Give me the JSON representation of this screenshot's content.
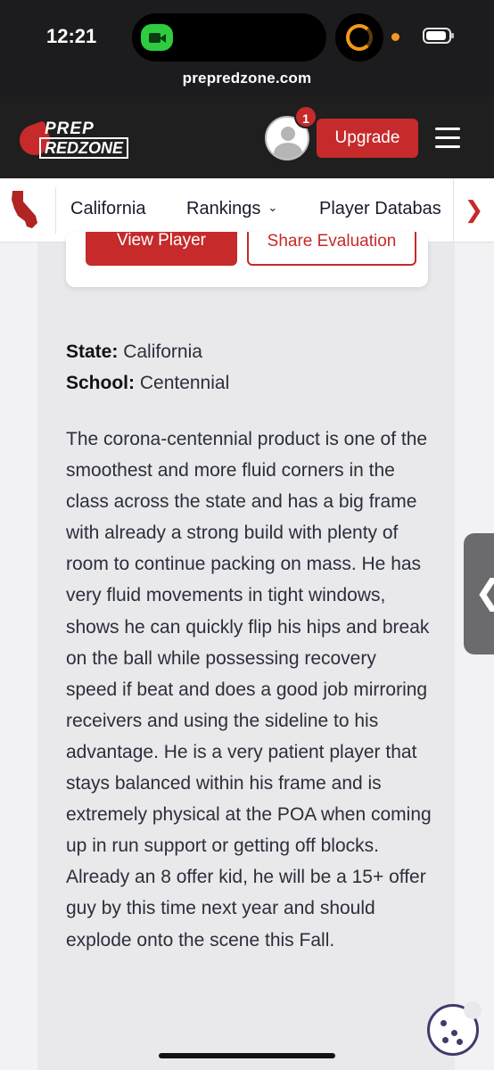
{
  "status_bar": {
    "time": "12:21",
    "url": "prepredzone.com",
    "icons": [
      "camera-icon",
      "timer-icon",
      "battery-icon"
    ],
    "colors": {
      "camera_pill": "#2ecc40",
      "timer": "#f19a1a"
    }
  },
  "header": {
    "logo_line1": "PREP",
    "logo_line2": "REDZONE",
    "notification_count": "1",
    "upgrade_label": "Upgrade",
    "icons": [
      "avatar-icon",
      "hamburger-menu-icon"
    ]
  },
  "nav": {
    "state_icon": "california-state-icon",
    "items": [
      {
        "label": "California"
      },
      {
        "label": "Rankings"
      },
      {
        "label": "Player Databas"
      }
    ],
    "next_icon": "chevron-right-icon"
  },
  "player_card": {
    "view_label": "View Player",
    "share_label": "Share Evaluation"
  },
  "info": {
    "state_label": "State:",
    "state_value": "California",
    "school_label": "School:",
    "school_value": "Centennial"
  },
  "evaluation": "The corona-centennial product is one of the smoothest and more fluid corners in the class across the state and has a big frame with already a strong build with plenty of room to continue packing on mass. He has very fluid movements in tight windows, shows he can quickly flip his hips and break on the ball while possessing recovery speed if beat and does a good job mirroring receivers and using the sideline to his advantage. He is a very patient player that stays balanced within his frame and is extremely physical at the POA when coming up in run support or getting off blocks. Already an 8 offer kid, he will be a 15+ offer guy by this time next year and should explode onto the scene this Fall.",
  "overlay": {
    "side_tab_icon": "chevron-left-icon",
    "cookie_icon": "cookie-icon"
  },
  "colors": {
    "brand_red": "#c62a2a",
    "header_bg": "#1f1f1f",
    "text": "#2b2f3a"
  }
}
